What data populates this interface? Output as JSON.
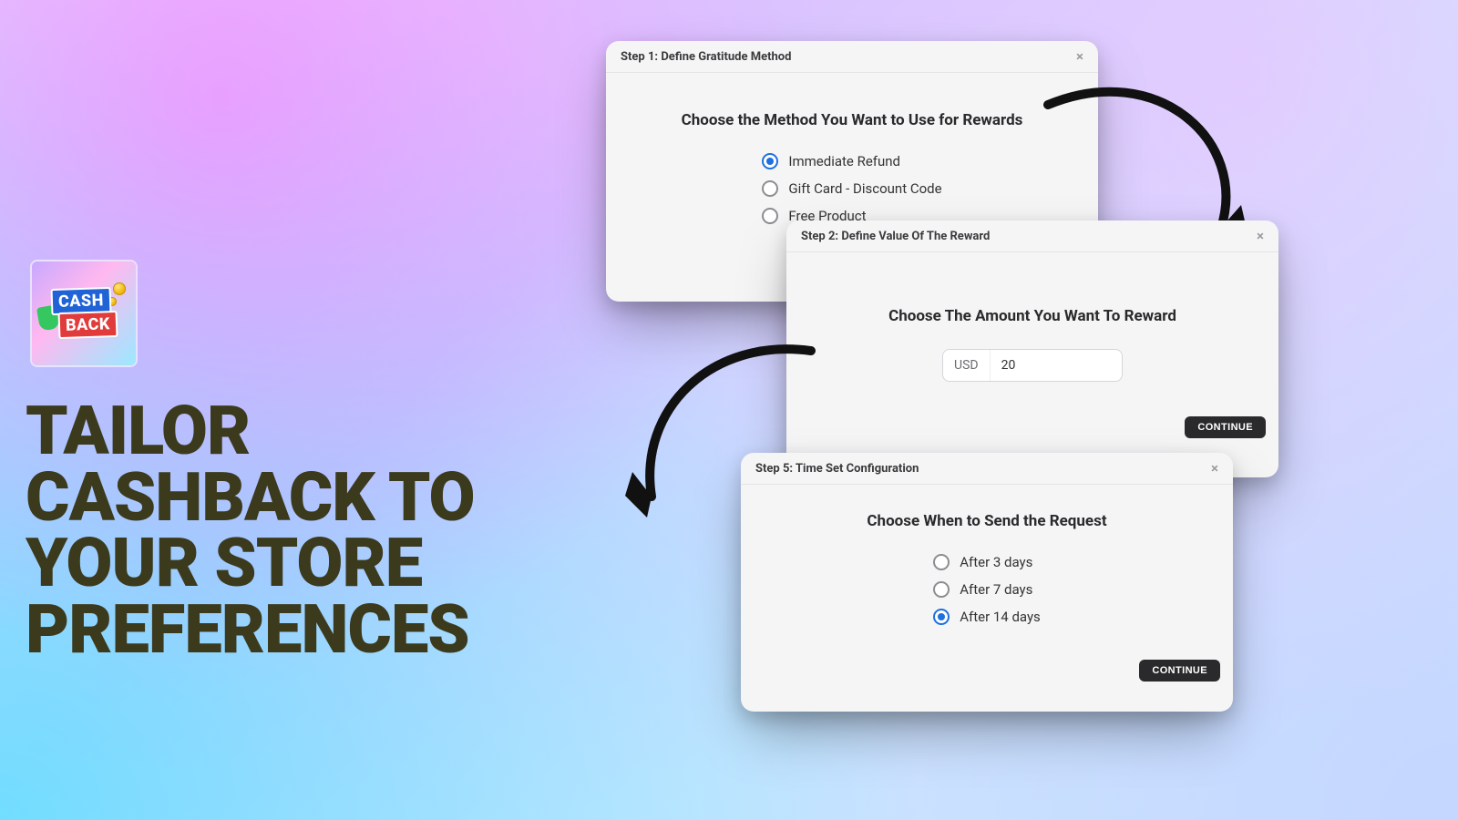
{
  "marketing": {
    "logo_cash": "CASH",
    "logo_back": "BACK",
    "headline": "TAILOR CASHBACK TO YOUR STORE PREFERENCES"
  },
  "step1": {
    "header": "Step 1: Define Gratitude Method",
    "title": "Choose the Method You Want to Use for Rewards",
    "options": [
      "Immediate Refund",
      "Gift Card - Discount Code",
      "Free Product"
    ],
    "selected_index": 0
  },
  "step2": {
    "header": "Step 2: Define Value Of The Reward",
    "title": "Choose The Amount You Want To Reward",
    "currency": "USD",
    "amount": "20",
    "continue_label": "CONTINUE"
  },
  "step5": {
    "header": "Step 5: Time Set Configuration",
    "title": "Choose When to Send the Request",
    "options": [
      "After 3 days",
      "After 7 days",
      "After 14 days"
    ],
    "selected_index": 2,
    "continue_label": "CONTINUE"
  }
}
